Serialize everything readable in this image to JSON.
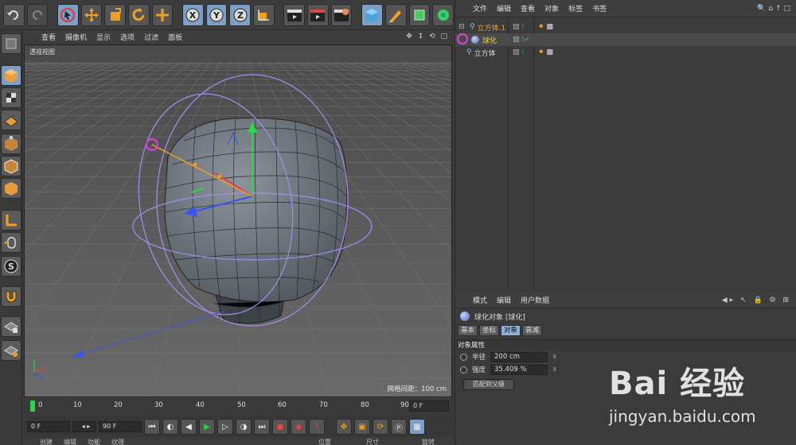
{
  "viewport": {
    "menu": [
      "查看",
      "摄像机",
      "显示",
      "选项",
      "过滤",
      "面板"
    ],
    "label": "透视视图",
    "grid_spacing": "网格间距：100 cm"
  },
  "timeline": {
    "ticks": [
      "0",
      "10",
      "20",
      "30",
      "40",
      "50",
      "60",
      "70",
      "80",
      "90"
    ],
    "end_frame": "0 F"
  },
  "playback": {
    "current": "0 F",
    "end": "90 F"
  },
  "bottom_tabs": {
    "left": [
      "创建",
      "编辑",
      "功能",
      "纹理"
    ],
    "right": [
      "位置",
      "尺寸",
      "旋转"
    ]
  },
  "object_manager": {
    "menu": [
      "文件",
      "编辑",
      "查看",
      "对象",
      "标签",
      "书签"
    ],
    "objects": [
      {
        "name": "立方体.1",
        "color": "#e8a24a"
      },
      {
        "name": "球化",
        "color": "#f2d23a"
      },
      {
        "name": "立方体",
        "color": "#d8d8d8"
      }
    ]
  },
  "attributes": {
    "menu": [
      "模式",
      "编辑",
      "用户数据"
    ],
    "title": "球化对象 [球化]",
    "tabs": [
      "基本",
      "坐标",
      "对象",
      "衰减"
    ],
    "active_tab": "对象",
    "section": "对象属性",
    "fields": [
      {
        "label": "半径",
        "value": "200 cm"
      },
      {
        "label": "强度",
        "value": "35.409 %"
      }
    ],
    "button": "匹配到父级"
  },
  "watermark": {
    "logo": "Bai 经验",
    "url": "jingyan.baidu.com"
  },
  "colors": {
    "accent_blue": "#7c9fc6",
    "panel": "#3c3c3c",
    "viewport": "#575757",
    "deformer_curve": "#a78cf0",
    "handle": "#e040e0"
  }
}
